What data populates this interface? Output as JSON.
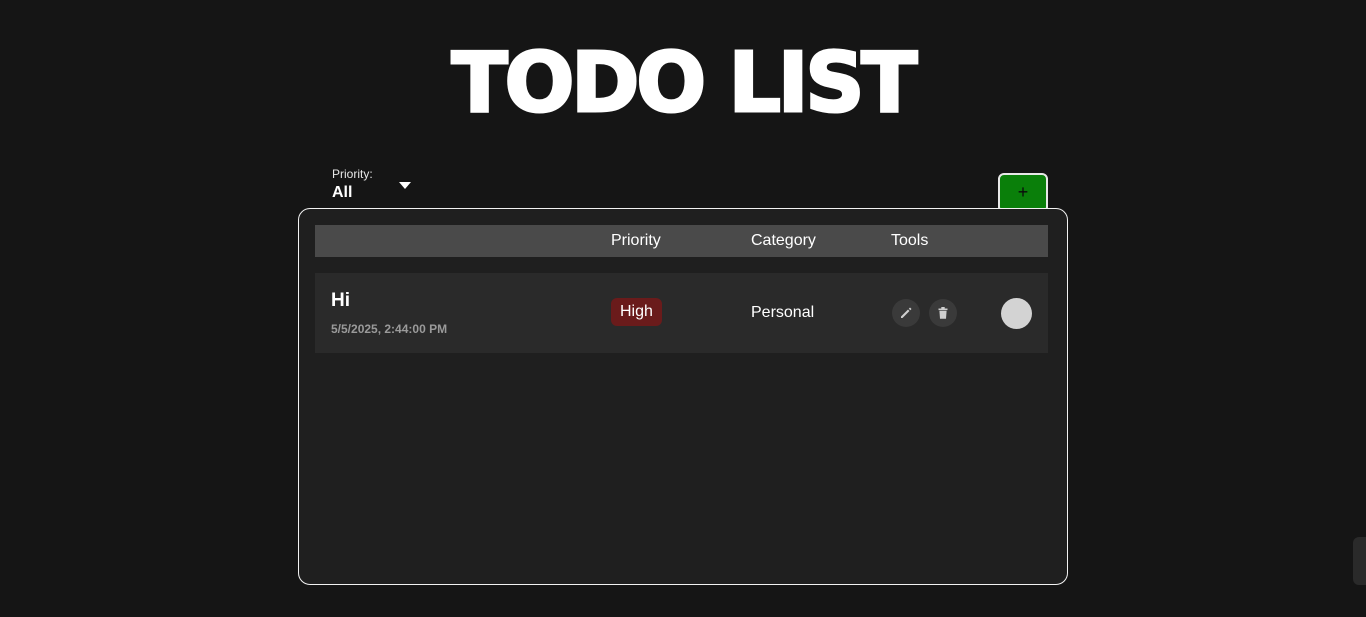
{
  "app": {
    "title": "TODO LIST"
  },
  "filter": {
    "label": "Priority:",
    "value": "All",
    "icon": "caret-down-icon"
  },
  "toolbar": {
    "add_label": "+"
  },
  "table": {
    "headers": {
      "priority": "Priority",
      "category": "Category",
      "tools": "Tools"
    }
  },
  "todos": [
    {
      "title": "Hi",
      "date": "5/5/2025, 2:44:00 PM",
      "priority": "High",
      "category": "Personal",
      "completed": false
    }
  ],
  "colors": {
    "background": "#151515",
    "panel": "#1f1f1f",
    "header": "#4a4a4a",
    "row": "#2a2a2a",
    "add_button": "#0a7f0a",
    "priority_high": "#6a1b1b"
  }
}
